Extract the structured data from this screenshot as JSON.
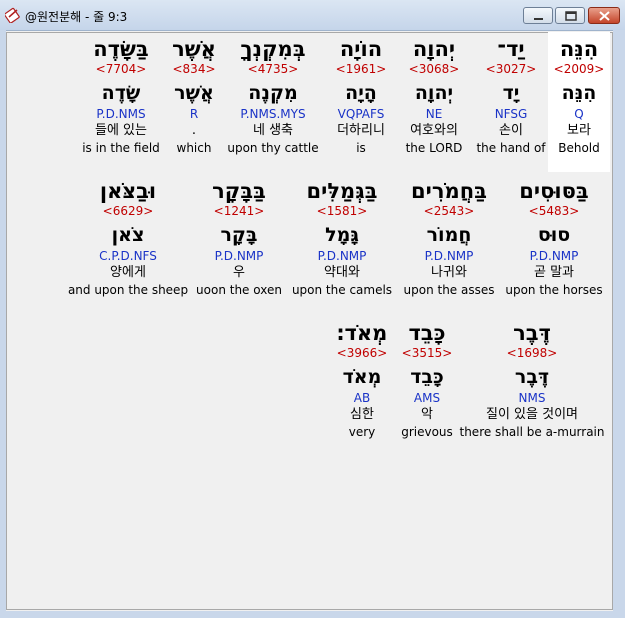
{
  "window": {
    "title": "@원전분해 - 줄 9:3",
    "buttons": {
      "minimize": "minimize-icon",
      "maximize": "maximize-icon",
      "close": "close-icon"
    }
  },
  "rows": [
    {
      "words": [
        {
          "hebrew": "הִנֵּה",
          "strong": "<2009>",
          "lemma": "הִנֵּה",
          "morph": "Q",
          "korean": "보라",
          "english": "Behold"
        },
        {
          "hebrew": "יַד־",
          "strong": "<3027>",
          "lemma": "יָד",
          "morph": "NFSG",
          "korean": "손이",
          "english": "the hand of"
        },
        {
          "hebrew": "יְהוָה",
          "strong": "<3068>",
          "lemma": "יְהוָה",
          "morph": "NE",
          "korean": "여호와의",
          "english": "the LORD"
        },
        {
          "hebrew": "הוֹיָה",
          "strong": "<1961>",
          "lemma": "הָיָה",
          "morph": "VQPAFS",
          "korean": "더하리니",
          "english": "is"
        },
        {
          "hebrew": "בְּמִקְנְךָ",
          "strong": "<4735>",
          "lemma": "מִקְנֶה",
          "morph": "P.NMS.MYS",
          "korean": "네 생축",
          "english": "upon thy cattle"
        },
        {
          "hebrew": "אֲשֶׁר",
          "strong": "<834>",
          "lemma": "אֲשֶׁר",
          "morph": "R",
          "korean": ".",
          "english": "which"
        },
        {
          "hebrew": "בַּשָּׂדֶה",
          "strong": "<7704>",
          "lemma": "שָׂדֶה",
          "morph": "P.D.NMS",
          "korean": "들에 있는",
          "english": "is in the field"
        }
      ]
    },
    {
      "words": [
        {
          "hebrew": "בַּסּוּסִים",
          "strong": "<5483>",
          "lemma": "סוּס",
          "morph": "P.D.NMP",
          "korean": "곧 말과",
          "english": "upon the horses"
        },
        {
          "hebrew": "בַּחֲמֹרִים",
          "strong": "<2543>",
          "lemma": "חֲמוֹר",
          "morph": "P.D.NMP",
          "korean": "나귀와",
          "english": "upon the asses"
        },
        {
          "hebrew": "בַּגְּמַלִּים",
          "strong": "<1581>",
          "lemma": "גָּמָל",
          "morph": "P.D.NMP",
          "korean": "약대와",
          "english": "upon the camels"
        },
        {
          "hebrew": "בַּבָּקָר",
          "strong": "<1241>",
          "lemma": "בָּקָר",
          "morph": "P.D.NMP",
          "korean": "우",
          "english": "uoon the oxen"
        },
        {
          "hebrew": "וּבַצֹּאן",
          "strong": "<6629>",
          "lemma": "צֹאן",
          "morph": "C.P.D.NFS",
          "korean": "양에게",
          "english": "and upon the sheep"
        }
      ]
    },
    {
      "words": [
        {
          "hebrew": "דֶּבֶר",
          "strong": "<1698>",
          "lemma": "דֶּבֶר",
          "morph": "NMS",
          "korean": "질이 있을 것이며",
          "english": "there shall be a-murrain"
        },
        {
          "hebrew": "כָּבֵד",
          "strong": "<3515>",
          "lemma": "כָּבֵד",
          "morph": "AMS",
          "korean": "악",
          "english": "grievous"
        },
        {
          "hebrew": "מְאֹד׃",
          "strong": "<3966>",
          "lemma": "מְאֹד",
          "morph": "AB",
          "korean": "심한",
          "english": "very"
        }
      ]
    }
  ]
}
